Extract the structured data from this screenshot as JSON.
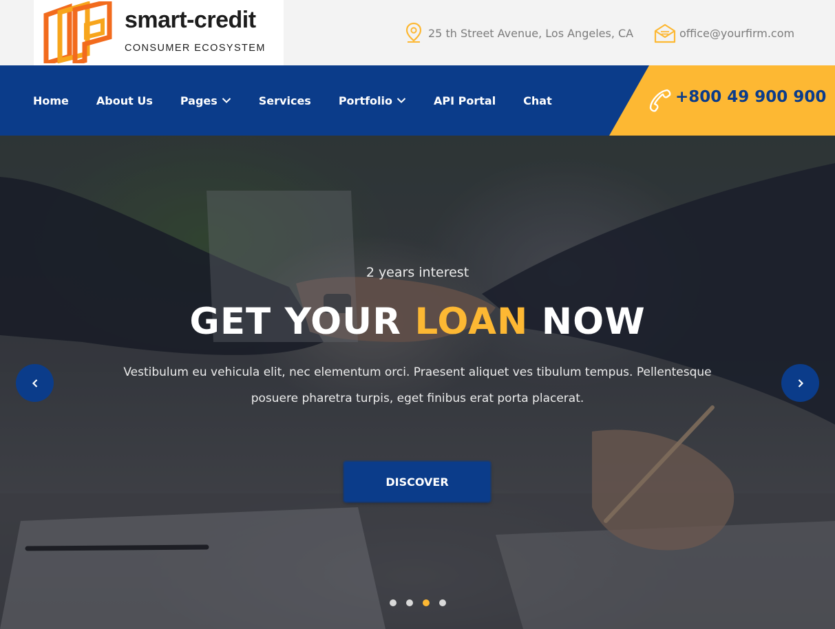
{
  "brand": {
    "name": "smart-credit",
    "tagline": "CONSUMER ECOSYSTEM",
    "colors": {
      "orange": "#f26b1d",
      "amber": "#f7a51c"
    }
  },
  "contact": {
    "address": {
      "icon": "location-pin-icon",
      "text": "25 th Street Avenue, Los Angeles, CA"
    },
    "email": {
      "icon": "envelope-icon",
      "text": "office@yourfirm.com"
    },
    "phone": {
      "icon": "phone-handset-icon",
      "text": "+800 49 900 900"
    }
  },
  "nav": {
    "items": [
      {
        "label": "Home",
        "has_dropdown": false
      },
      {
        "label": "About Us",
        "has_dropdown": false
      },
      {
        "label": "Pages",
        "has_dropdown": true
      },
      {
        "label": "Services",
        "has_dropdown": false
      },
      {
        "label": "Portfolio",
        "has_dropdown": true
      },
      {
        "label": "API Portal",
        "has_dropdown": false
      },
      {
        "label": "Chat",
        "has_dropdown": false
      }
    ]
  },
  "hero": {
    "kicker": "2 years interest",
    "title_part1": "GET YOUR ",
    "title_accent": "LOAN",
    "title_part2": " NOW",
    "description": "Vestibulum eu vehicula elit, nec elementum orci. Praesent aliquet ves tibulum tempus. Pellentesque posuere pharetra turpis, eget finibus erat porta placerat.",
    "cta_label": "DISCOVER",
    "prev_icon": "chevron-left-icon",
    "next_icon": "chevron-right-icon",
    "slides_total": 4,
    "active_slide": 3
  },
  "theme": {
    "primary": "#0b3c8a",
    "accent": "#fdb833",
    "topbar_bg": "#f3f3f3",
    "muted_text": "#7c7c7c"
  }
}
